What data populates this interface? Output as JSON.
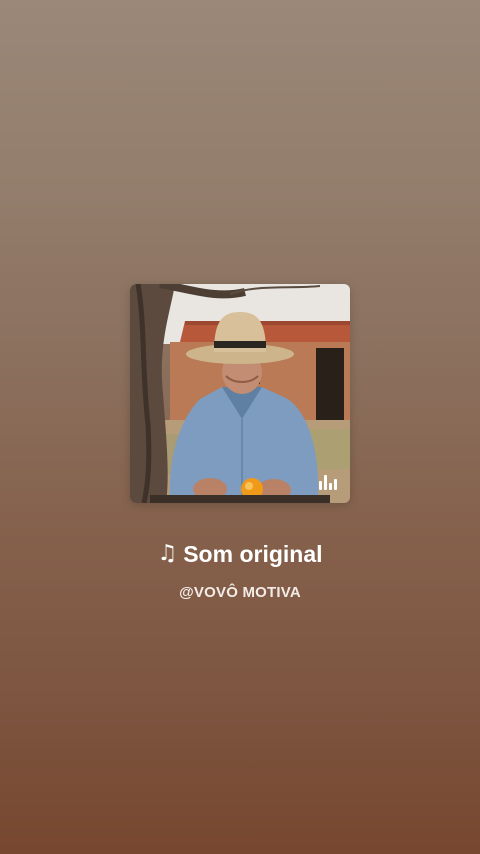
{
  "sound": {
    "title": "Som original",
    "author": "@VOVÔ MOTIVA",
    "note_icon": "♫",
    "cover_icon": "music-note-icon",
    "playing_indicator_icon": "equalizer-icon"
  },
  "colors": {
    "background_top": "#9b8878",
    "background_bottom": "#77472f",
    "text": "#ffffff"
  }
}
